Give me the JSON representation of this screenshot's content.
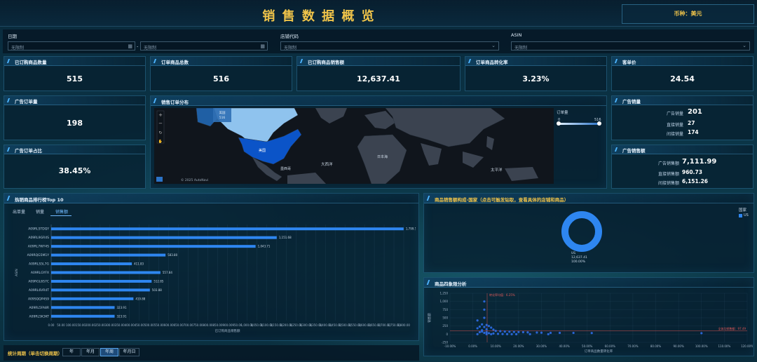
{
  "header": {
    "title": "销 售 数 据 概 览",
    "currency": "币种：美元"
  },
  "filters": {
    "date_label": "日期",
    "date_start": "无限制",
    "date_sep": "-",
    "date_end": "无限制",
    "shop_label": "店铺代码",
    "shop_value": "无限制",
    "asin_label": "ASIN",
    "asin_value": "无限制"
  },
  "kpis": {
    "ordered_qty": {
      "label": "已订购商品数量",
      "value": "515"
    },
    "order_total": {
      "label": "订单商品总数",
      "value": "516"
    },
    "ordered_sales": {
      "label": "已订购商品销售额",
      "value": "12,637.41"
    },
    "conversion": {
      "label": "订单商品转化率",
      "value": "3.23%"
    },
    "unit_price": {
      "label": "客单价",
      "value": "24.54"
    },
    "ad_orders": {
      "label": "广告订单量",
      "value": "198"
    },
    "ad_order_ratio": {
      "label": "广告订单占比",
      "value": "38.45%"
    }
  },
  "ad_sales_qty": {
    "label": "广告销量",
    "rows": [
      {
        "k": "广告销量",
        "v": "201"
      },
      {
        "k": "直接销量",
        "v": "27"
      },
      {
        "k": "间接销量",
        "v": "174"
      }
    ]
  },
  "ad_sales_amt": {
    "label": "广告销售额",
    "rows": [
      {
        "k": "广告销售额",
        "v": "7,111.99"
      },
      {
        "k": "直接销售额",
        "v": "960.73"
      },
      {
        "k": "间接销售额",
        "v": "6,151.26"
      }
    ]
  },
  "map": {
    "title": "销售订单分布",
    "popup_country": "美国",
    "popup_value": "516",
    "label_atlantic": "大西洋",
    "label_pacific": "太平洋",
    "label_japan": "日本海",
    "label_mexico": "墨西哥",
    "zoom_in": "+",
    "zoom_out": "−",
    "reset": "↻",
    "hand": "✋",
    "attribution": "© 2025 AutoNavi",
    "legend_title": "订单量",
    "legend_min": "0",
    "legend_max": "516"
  },
  "top_chart": {
    "title": "热销商品排行榜Top 10",
    "tabs": [
      "出单量",
      "销量",
      "销售额"
    ],
    "active_tab": "销售额",
    "ylabel": "ASIN",
    "xlabel": "已订购商品销售额"
  },
  "chart_data": [
    {
      "type": "bar",
      "orientation": "horizontal",
      "categories": [
        "A09RLSTDQY",
        "A09RL9GR4S",
        "A09RL7WY4S",
        "A09RQG5M1Y",
        "A09RLS5L7G",
        "A09RLGYFX",
        "A09RGL6S7C",
        "A09RL6VR4T",
        "A09SQQP4S9",
        "A09RL5FA8R",
        "A09RLSK3KT"
      ],
      "values": [
        1799.5,
        1151.68,
        1043.71,
        583.8,
        411.83,
        557.84,
        512.85,
        503.88,
        419.88,
        323.91,
        323.91
      ],
      "labels": [
        "1,799.50",
        "1,151.68",
        "1,043.71",
        "583.80",
        "411.83",
        "557.84",
        "512.85",
        "503.88",
        "419.88",
        "323.91",
        "323.91"
      ],
      "xticks": [
        "0.00",
        "50.00",
        "100.00",
        "150.00",
        "200.00",
        "250.00",
        "300.00",
        "350.00",
        "400.00",
        "450.00",
        "500.00",
        "550.00",
        "600.00",
        "650.00",
        "700.00",
        "750.00",
        "800.00",
        "850.00",
        "900.00",
        "950.00",
        "1,000.00",
        "1,050.00",
        "1,100.00",
        "1,150.00",
        "1,200.00",
        "1,250.00",
        "1,300.00",
        "1,350.00",
        "1,400.00",
        "1,450.00",
        "1,500.00",
        "1,550.00",
        "1,600.00",
        "1,650.00",
        "1,700.00",
        "1,750.00",
        "1,800.00"
      ],
      "xlim": [
        0,
        1800
      ],
      "xlabel": "已订购商品销售额",
      "ylabel": "ASIN",
      "color": "#2e86f0"
    },
    {
      "type": "pie",
      "title": "商品销售额构成-国家（点击可触发钻取，查看具体的店铺和商品）",
      "slices": [
        {
          "name": "US",
          "value": 12637.41,
          "percent": "100.00%"
        }
      ],
      "center_label": "US",
      "center_value": "12,637.41",
      "center_pct": "100.00%",
      "legend_title": "国家",
      "legend_item": "US",
      "color": "#2e86f0"
    },
    {
      "type": "scatter",
      "title": "商品四象限分析",
      "xlabel": "订单商品数量转化率",
      "ylabel": "销售额",
      "xticks": [
        "-10.00%",
        "0.00%",
        "10.00%",
        "20.00%",
        "30.00%",
        "40.00%",
        "50.00%",
        "60.00%",
        "70.00%",
        "80.00%",
        "90.00%",
        "100.00%",
        "110.00%",
        "120.00%"
      ],
      "yticks": [
        "1,250",
        "1,000",
        "750",
        "500",
        "250",
        "0",
        "-250"
      ],
      "xlim": [
        -10,
        120
      ],
      "ylim": [
        -250,
        1250
      ],
      "points": [
        [
          5,
          1000
        ],
        [
          5,
          750
        ],
        [
          5,
          500
        ],
        [
          2,
          420
        ],
        [
          4,
          300
        ],
        [
          6,
          280
        ],
        [
          7,
          250
        ],
        [
          3,
          230
        ],
        [
          5,
          220
        ],
        [
          8,
          200
        ],
        [
          2,
          180
        ],
        [
          6,
          150
        ],
        [
          9,
          140
        ],
        [
          4,
          120
        ],
        [
          10,
          100
        ],
        [
          12,
          90
        ],
        [
          14,
          80
        ],
        [
          16,
          75
        ],
        [
          18,
          70
        ],
        [
          20,
          65
        ],
        [
          22,
          60
        ],
        [
          24,
          55
        ],
        [
          28,
          50
        ],
        [
          30,
          45
        ],
        [
          34,
          40
        ],
        [
          38,
          40
        ],
        [
          44,
          38
        ],
        [
          52,
          35
        ],
        [
          3,
          60
        ],
        [
          5,
          40
        ],
        [
          7,
          30
        ],
        [
          9,
          20
        ],
        [
          11,
          10
        ],
        [
          13,
          5
        ],
        [
          15,
          2
        ],
        [
          17,
          0
        ],
        [
          19,
          0
        ],
        [
          25,
          0
        ],
        [
          33,
          0
        ],
        [
          6,
          0
        ],
        [
          8,
          0
        ],
        [
          2,
          0
        ],
        [
          4,
          80
        ],
        [
          6,
          60
        ],
        [
          100,
          30
        ]
      ],
      "vline_label": "转化率均值：6.25%",
      "hline_label": "全体均销售额：97.49",
      "vline": 6.25,
      "hline": 97.49,
      "color": "#2e6ee8"
    }
  ],
  "period": {
    "label": "统计周期（单击切换周期）",
    "buttons": [
      "年",
      "年月",
      "年周",
      "年月日"
    ],
    "active": "年周"
  }
}
